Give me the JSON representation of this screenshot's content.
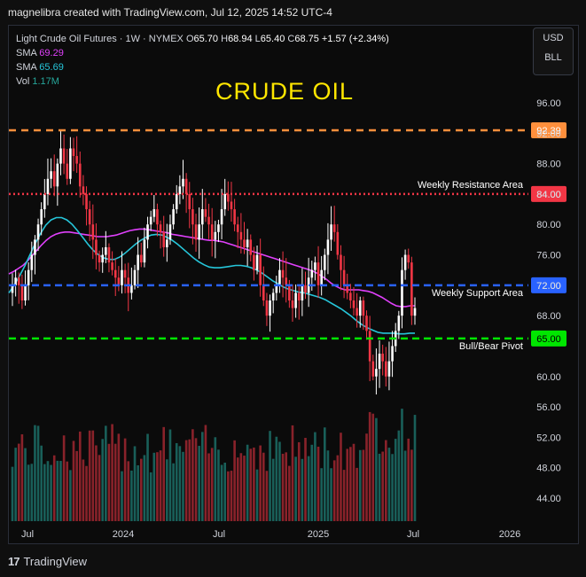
{
  "credit": "magnelibra created with TradingView.com, Jul 12, 2025 14:52 UTC-4",
  "legend": {
    "instrument": "Light Crude Oil Futures · 1W · NYMEX",
    "o_label": "O",
    "o": "65.70",
    "h_label": "H",
    "h": "68.94",
    "l_label": "L",
    "l": "65.40",
    "c_label": "C",
    "c": "68.75",
    "change": "+1.57 (+2.34%)",
    "sma1_label": "SMA",
    "sma1": "69.29",
    "sma2_label": "SMA",
    "sma2": "65.69",
    "vol_label": "Vol",
    "vol": "1.17M"
  },
  "units": {
    "currency": "USD",
    "unit": "BLL"
  },
  "footer": {
    "brand": "TradingView",
    "brand_mark": "17"
  },
  "chart_data": {
    "type": "candlestick",
    "title": "CRUDE OIL",
    "ylim": [
      40.0,
      97.5
    ],
    "y_ticks": [
      "96.00",
      "92.00",
      "88.00",
      "84.00",
      "80.00",
      "76.00",
      "72.00",
      "68.00",
      "64.00",
      "60.00",
      "56.00",
      "52.00",
      "48.00",
      "44.00"
    ],
    "x_ticks": [
      "Jul",
      "2024",
      "Jul",
      "2025",
      "Jul",
      "2026"
    ],
    "levels": [
      {
        "label": "",
        "value": 92.39,
        "value_label": "92.39",
        "color": "#ff8f3c"
      },
      {
        "label": "Weekly Resistance Area",
        "value": 84.0,
        "value_label": "84.00",
        "color": "#f23645"
      },
      {
        "label": "Weekly Support Area",
        "value": 72.0,
        "value_label": "72.00",
        "color": "#2962ff"
      },
      {
        "label": "Bull/Bear Pivot",
        "value": 65.0,
        "value_label": "65.00",
        "color": "#00e600"
      }
    ],
    "close": [
      72,
      73,
      72,
      70,
      72,
      74,
      76,
      78,
      80,
      82,
      84,
      86,
      87,
      85,
      88,
      90,
      88,
      86,
      90,
      89,
      88,
      85,
      84,
      82,
      80,
      78,
      76,
      75,
      76,
      77,
      75,
      74,
      73,
      72,
      74,
      73,
      71,
      72,
      74,
      76,
      75,
      78,
      80,
      81,
      82,
      80,
      79,
      77,
      78,
      80,
      82,
      84,
      85,
      86,
      84,
      82,
      80,
      78,
      80,
      82,
      81,
      80,
      78,
      79,
      80,
      82,
      84,
      83,
      82,
      80,
      79,
      78,
      77,
      78,
      76,
      74,
      76,
      72,
      70,
      68,
      70,
      71,
      72,
      74,
      73,
      72,
      70,
      69,
      71,
      70,
      72,
      71,
      73,
      74,
      75,
      72,
      74,
      76,
      78,
      80,
      79,
      76,
      74,
      72,
      71,
      70,
      69,
      68,
      70,
      68,
      66,
      62,
      60,
      61,
      63,
      62,
      60,
      62,
      64,
      66,
      68,
      74,
      76,
      75,
      68,
      69
    ],
    "sma1": [
      73.5,
      73.8,
      74.2,
      74.6,
      75.2,
      75.9,
      76.6,
      77.3,
      77.9,
      78.4,
      78.7,
      78.9,
      79.0,
      79.0,
      78.9,
      78.8,
      78.7,
      78.6,
      78.5,
      78.4,
      78.4,
      78.4,
      78.5,
      78.6,
      78.8,
      79.0,
      79.2,
      79.3,
      79.4,
      79.4,
      79.3,
      79.2,
      79.1,
      79.0,
      78.9,
      78.7,
      78.6,
      78.5,
      78.4,
      78.3,
      78.2,
      78.1,
      78.0,
      77.9,
      77.9,
      77.8,
      77.7,
      77.5,
      77.3,
      77.1,
      76.9,
      76.7,
      76.5,
      76.3,
      76.1,
      75.9,
      75.7,
      75.5,
      75.3,
      75.1,
      74.9,
      74.7,
      74.5,
      74.3,
      74.1,
      73.9,
      73.6,
      73.2,
      72.8,
      72.3,
      71.9,
      71.6,
      71.4,
      71.4,
      71.4,
      71.4,
      71.3,
      71.2,
      71.0,
      70.7,
      70.4,
      70.0,
      69.6,
      69.3,
      69.2,
      69.2,
      69.3,
      69.3
    ],
    "sma2": [
      71.0,
      72.0,
      73.2,
      74.5,
      76.0,
      77.5,
      78.8,
      79.9,
      80.6,
      80.9,
      80.9,
      80.6,
      80.0,
      79.2,
      78.3,
      77.4,
      76.6,
      76.0,
      75.6,
      75.4,
      75.4,
      75.7,
      76.2,
      76.8,
      77.4,
      77.9,
      78.3,
      78.6,
      78.7,
      78.6,
      78.3,
      77.9,
      77.4,
      76.8,
      76.2,
      75.6,
      75.1,
      74.7,
      74.4,
      74.3,
      74.3,
      74.4,
      74.5,
      74.6,
      74.6,
      74.5,
      74.3,
      74.0,
      73.6,
      73.1,
      72.6,
      72.2,
      71.8,
      71.5,
      71.3,
      71.1,
      71.0,
      70.8,
      70.6,
      70.4,
      70.1,
      69.7,
      69.3,
      68.9,
      68.4,
      67.9,
      67.3,
      66.8,
      66.4,
      66.1,
      65.8,
      65.7,
      65.7,
      65.7,
      65.6,
      65.6,
      65.7,
      65.7
    ]
  }
}
